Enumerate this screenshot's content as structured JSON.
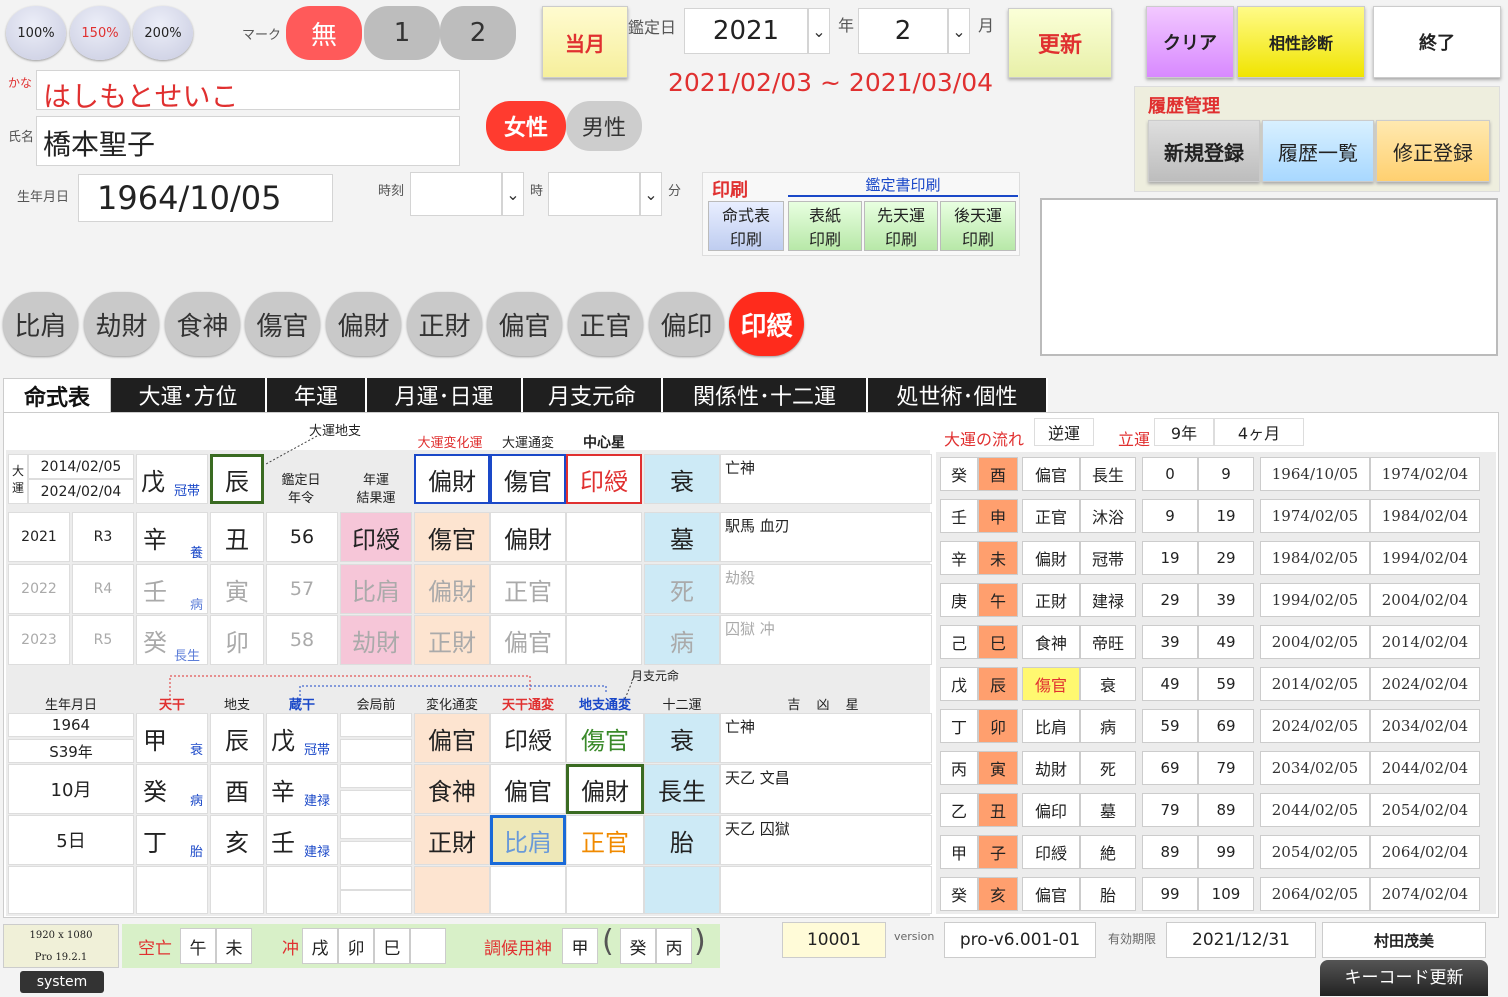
{
  "zoom": {
    "z100": "100%",
    "z150": "150%",
    "z200": "200%"
  },
  "mark": {
    "label": "マーク",
    "none": "無",
    "one": "1",
    "two": "2"
  },
  "person": {
    "kana_label": "かな",
    "kana": "はしもとせいこ",
    "name_label": "氏名",
    "name": "橋本聖子",
    "birth_label": "生年月日",
    "birth": "1964/10/05",
    "time_label": "時刻",
    "hour_unit": "時",
    "min_unit": "分"
  },
  "gender": {
    "female": "女性",
    "male": "男性"
  },
  "appraisal": {
    "this_month": "当月",
    "date_label": "鑑定日",
    "year": "2021",
    "year_unit": "年",
    "month": "2",
    "month_unit": "月",
    "update": "更新",
    "range": "2021/02/03 ~ 2021/03/04"
  },
  "top_buttons": {
    "clear": "クリア",
    "compat": "相性診断",
    "exit": "終了"
  },
  "history": {
    "title": "履歴管理",
    "new": "新規登録",
    "list": "履歴一覧",
    "edit": "修正登録"
  },
  "print": {
    "title": "印刷",
    "sub_title": "鑑定書印刷",
    "b1a": "命式表",
    "b1b": "印刷",
    "b2a": "表紙",
    "b2b": "印刷",
    "b3a": "先天運",
    "b3b": "印刷",
    "b4a": "後天運",
    "b4b": "印刷"
  },
  "stars": [
    "比肩",
    "劫財",
    "食神",
    "傷官",
    "偏財",
    "正財",
    "偏官",
    "正官",
    "偏印",
    "印綬"
  ],
  "tabs": [
    "命式表",
    "大運･方位",
    "年運",
    "月運･日運",
    "月支元命",
    "関係性･十二運",
    "処世術･個性"
  ],
  "taiun": {
    "label1": "大",
    "label2": "運",
    "d1": "2014/02/05",
    "d2": "2024/02/04",
    "stem": "戊",
    "stem_sub": "冠帯",
    "branch": "辰",
    "lbl_branch": "大運地支",
    "lbl_day": "鑑定日",
    "lbl_age": "年令",
    "lbl_nen": "年運",
    "lbl_res": "結果運",
    "lbl_hen": "大運変化運",
    "lbl_tsu": "大運通変",
    "lbl_chu": "中心星",
    "hen": "偏財",
    "tsu": "傷官",
    "chu": "印綬",
    "twelve": "衰",
    "stars_txt": "亡神"
  },
  "yearrows": [
    {
      "year": "2021",
      "era": "R3",
      "stem": "辛",
      "sub": "養",
      "branch": "丑",
      "age": "56",
      "nen": "印綬",
      "a": "傷官",
      "b": "偏財",
      "twelve": "墓",
      "stars": "駅馬 血刃"
    },
    {
      "year": "2022",
      "era": "R4",
      "stem": "壬",
      "sub": "病",
      "branch": "寅",
      "age": "57",
      "nen": "比肩",
      "a": "偏財",
      "b": "正官",
      "twelve": "死",
      "stars": "劫殺"
    },
    {
      "year": "2023",
      "era": "R5",
      "stem": "癸",
      "sub": "長生",
      "branch": "卯",
      "age": "58",
      "nen": "劫財",
      "a": "正財",
      "b": "偏官",
      "twelve": "病",
      "stars": "囚獄 冲"
    }
  ],
  "meishiki": {
    "h_birth": "生年月日",
    "h_ten": "天干",
    "h_chi": "地支",
    "h_zou": "蔵干",
    "h_kai": "会局前",
    "h_hen": "変化通変",
    "h_tt": "天干通変",
    "h_ct": "地支通変",
    "h_12": "十二運",
    "h_kk": "吉 凶 星",
    "h_gsg": "月支元命",
    "rows": [
      {
        "b1": "1964",
        "b2": "S39年",
        "ten": "甲",
        "tsub": "衰",
        "chi": "辰",
        "zou": "戊",
        "zsub": "冠帯",
        "hen": "偏官",
        "tt": "印綬",
        "ct": "傷官",
        "twelve": "衰",
        "stars": "亡神"
      },
      {
        "b1": "10月",
        "b2": "",
        "ten": "癸",
        "tsub": "病",
        "chi": "酉",
        "zou": "辛",
        "zsub": "建禄",
        "hen": "食神",
        "tt": "偏官",
        "ct": "偏財",
        "twelve": "長生",
        "stars": "天乙 文昌"
      },
      {
        "b1": "5日",
        "b2": "",
        "ten": "丁",
        "tsub": "胎",
        "chi": "亥",
        "zou": "壬",
        "zsub": "建禄",
        "hen": "正財",
        "tt": "比肩",
        "ct": "正官",
        "twelve": "胎",
        "stars": "天乙 囚獄"
      }
    ]
  },
  "flow": {
    "title": "大運の流れ",
    "dir": "逆運",
    "rittai": "立運",
    "years": "9年",
    "months": "4ヶ月",
    "rows": [
      {
        "s": "癸",
        "b": "酉",
        "t": "偏官",
        "tw": "長生",
        "a": "0",
        "e": "9",
        "d1": "1964/10/05",
        "d2": "1974/02/04"
      },
      {
        "s": "壬",
        "b": "申",
        "t": "正官",
        "tw": "沐浴",
        "a": "9",
        "e": "19",
        "d1": "1974/02/05",
        "d2": "1984/02/04"
      },
      {
        "s": "辛",
        "b": "未",
        "t": "偏財",
        "tw": "冠帯",
        "a": "19",
        "e": "29",
        "d1": "1984/02/05",
        "d2": "1994/02/04"
      },
      {
        "s": "庚",
        "b": "午",
        "t": "正財",
        "tw": "建禄",
        "a": "29",
        "e": "39",
        "d1": "1994/02/05",
        "d2": "2004/02/04"
      },
      {
        "s": "己",
        "b": "巳",
        "t": "食神",
        "tw": "帝旺",
        "a": "39",
        "e": "49",
        "d1": "2004/02/05",
        "d2": "2014/02/04"
      },
      {
        "s": "戊",
        "b": "辰",
        "t": "傷官",
        "tw": "衰",
        "a": "49",
        "e": "59",
        "d1": "2014/02/05",
        "d2": "2024/02/04"
      },
      {
        "s": "丁",
        "b": "卯",
        "t": "比肩",
        "tw": "病",
        "a": "59",
        "e": "69",
        "d1": "2024/02/05",
        "d2": "2034/02/04"
      },
      {
        "s": "丙",
        "b": "寅",
        "t": "劫財",
        "tw": "死",
        "a": "69",
        "e": "79",
        "d1": "2034/02/05",
        "d2": "2044/02/04"
      },
      {
        "s": "乙",
        "b": "丑",
        "t": "偏印",
        "tw": "墓",
        "a": "79",
        "e": "89",
        "d1": "2044/02/05",
        "d2": "2054/02/04"
      },
      {
        "s": "甲",
        "b": "子",
        "t": "印綬",
        "tw": "絶",
        "a": "89",
        "e": "99",
        "d1": "2054/02/05",
        "d2": "2064/02/04"
      },
      {
        "s": "癸",
        "b": "亥",
        "t": "偏官",
        "tw": "胎",
        "a": "99",
        "e": "109",
        "d1": "2064/02/05",
        "d2": "2074/02/04"
      }
    ]
  },
  "footer": {
    "res": "1920 x 1080",
    "pro": "Pro 19.2.1",
    "system": "system",
    "kubou": "空亡",
    "k1": "午",
    "k2": "未",
    "chu": "冲",
    "c1": "戌",
    "c2": "卯",
    "c3": "巳",
    "chouko": "調候用神",
    "ch1": "甲",
    "ch2": "癸",
    "ch3": "丙",
    "id": "10001",
    "ver_label": "version",
    "ver": "pro-v6.001-01",
    "exp_label": "有効期限",
    "exp": "2021/12/31",
    "user": "村田茂美",
    "keycode": "キーコード更新"
  }
}
